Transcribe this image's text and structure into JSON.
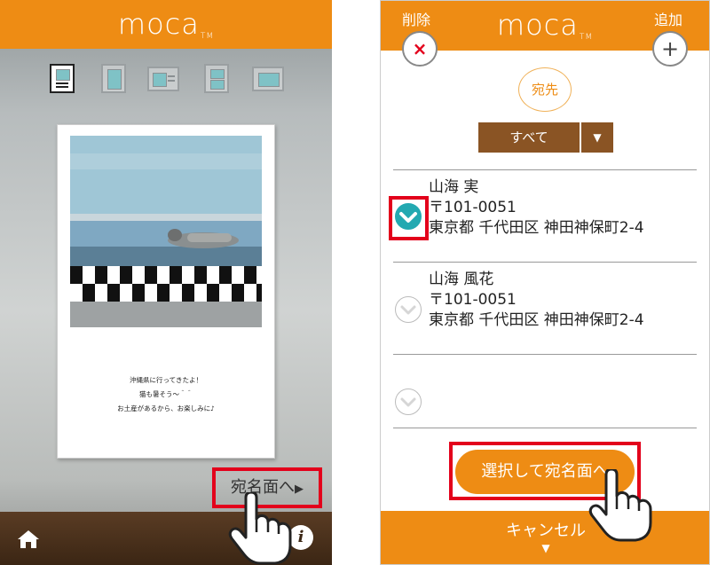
{
  "left": {
    "app_logo": "moca",
    "app_logo_tm": "TM",
    "message_lines": [
      "沖縄県に行ってきたよ！",
      "猫も暑そう〜＾＾",
      "お土産があるから、お楽しみに♪"
    ],
    "to_address_button": "宛名面へ",
    "to_address_arrow": "▶",
    "home_icon": "home-icon",
    "info_icon": "info-icon",
    "info_glyph": "i"
  },
  "right": {
    "app_logo": "moca",
    "app_logo_tm": "TM",
    "delete_label": "削除",
    "add_label": "追加",
    "delete_glyph": "×",
    "add_glyph": "+",
    "section_label": "宛先",
    "filter": {
      "value": "すべて",
      "arrow": "▼"
    },
    "contacts": [
      {
        "name": "山海 実",
        "postal": "〒101-0051",
        "address": "東京都 千代田区 神田神保町2-4",
        "checked": true
      },
      {
        "name": "山海 風花",
        "postal": "〒101-0051",
        "address": "東京都 千代田区 神田神保町2-4",
        "checked": false
      },
      {
        "name": "",
        "postal": "",
        "address": "",
        "checked": false
      }
    ],
    "select_button": "選択して宛名面へ",
    "cancel_label": "キャンセル",
    "cancel_arrow": "▼"
  },
  "colors": {
    "brand_orange": "#ee8c14",
    "teal_check": "#23a9b1",
    "filter_brown": "#8a5424",
    "highlight_red": "#e3001b"
  }
}
